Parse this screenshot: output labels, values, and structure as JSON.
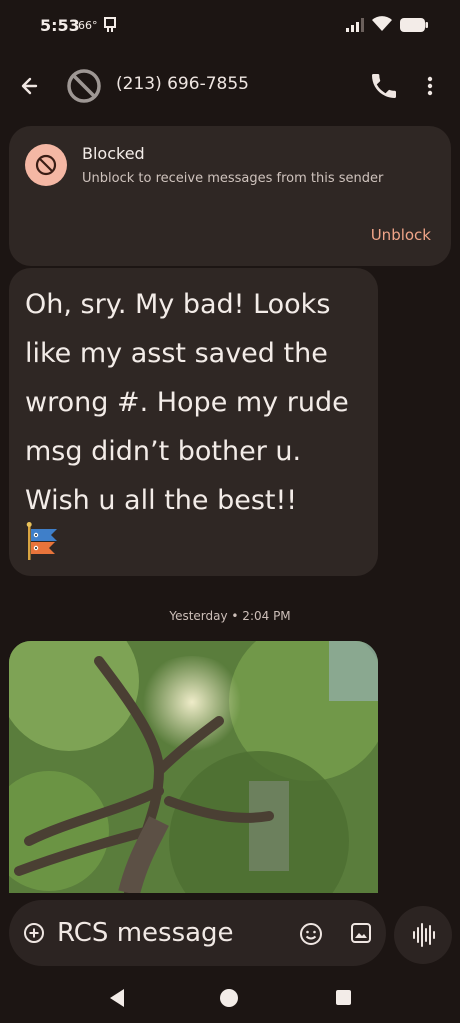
{
  "status": {
    "time": "5:53",
    "temp": "66°"
  },
  "header": {
    "contact": "(213) 696-7855"
  },
  "blocked": {
    "title": "Blocked",
    "description": "Unblock to receive messages from this sender",
    "action": "Unblock"
  },
  "message": {
    "text": "Oh, sry. My bad! Looks like my asst saved the wrong #. Hope my rude msg didn’t bother u. Wish u all the best!!",
    "emoji": "🎏"
  },
  "timestamp": "Yesterday • 2:04 PM",
  "composer": {
    "placeholder": "RCS message"
  },
  "colors": {
    "background": "#1c1513",
    "bubble": "#2f2724",
    "accent": "#f0a488",
    "blocked_icon_bg": "#f4b7a4"
  },
  "icons": [
    "back-arrow-icon",
    "blocked-avatar-icon",
    "phone-icon",
    "more-vert-icon",
    "block-icon",
    "add-icon",
    "emoji-icon",
    "gallery-icon",
    "voice-waveform-icon"
  ]
}
